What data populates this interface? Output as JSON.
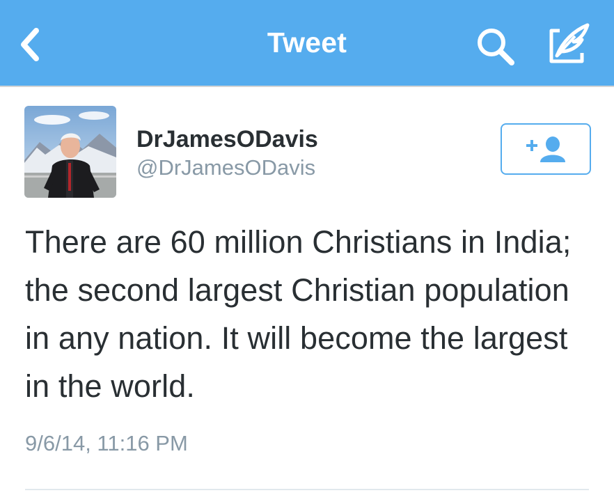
{
  "navbar": {
    "title": "Tweet",
    "background_color": "#55acee",
    "back_icon": "chevron-left-icon",
    "search_icon": "search-icon",
    "compose_icon": "compose-tweet-icon"
  },
  "tweet": {
    "author": {
      "display_name": "DrJamesODavis",
      "handle": "@DrJamesODavis",
      "avatar": "profile-photo"
    },
    "follow_button_icon": "follow-user-icon",
    "text": "There are 60 million Christians in India; the second largest Christian population in any nation. It will become the largest in the world.",
    "timestamp": "9/6/14, 11:16 PM"
  },
  "colors": {
    "accent": "#55acee",
    "text_primary": "#292f33",
    "text_secondary": "#8899a6"
  }
}
